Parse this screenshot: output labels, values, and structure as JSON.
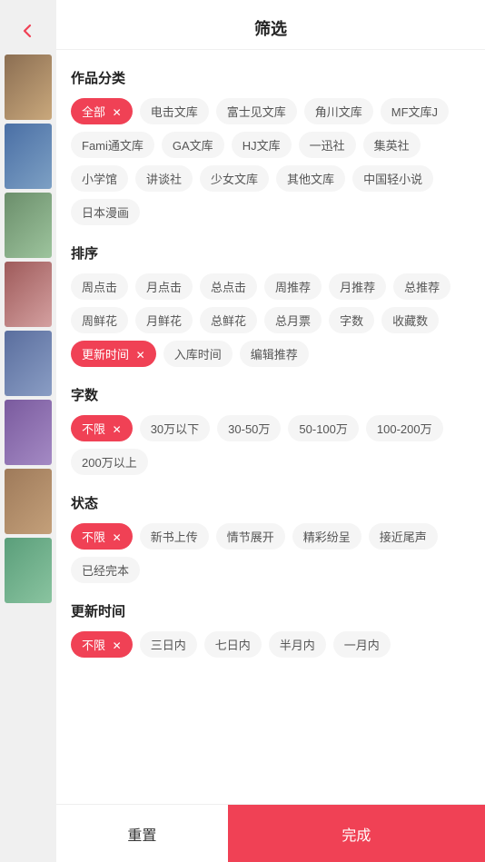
{
  "header": {
    "title": "筛选",
    "back_icon": "‹"
  },
  "sections": {
    "category": {
      "title": "作品分类",
      "tags": [
        {
          "label": "全部",
          "active": true,
          "has_close": true
        },
        {
          "label": "电击文库",
          "active": false
        },
        {
          "label": "富士见文库",
          "active": false
        },
        {
          "label": "角川文库",
          "active": false
        },
        {
          "label": "MF文库J",
          "active": false
        },
        {
          "label": "Fami通文库",
          "active": false
        },
        {
          "label": "GA文库",
          "active": false
        },
        {
          "label": "HJ文库",
          "active": false
        },
        {
          "label": "一迅社",
          "active": false
        },
        {
          "label": "集英社",
          "active": false
        },
        {
          "label": "小学馆",
          "active": false
        },
        {
          "label": "讲谈社",
          "active": false
        },
        {
          "label": "少女文库",
          "active": false
        },
        {
          "label": "其他文库",
          "active": false
        },
        {
          "label": "中国轻小说",
          "active": false
        },
        {
          "label": "日本漫画",
          "active": false
        }
      ]
    },
    "sort": {
      "title": "排序",
      "tags": [
        {
          "label": "周点击",
          "active": false
        },
        {
          "label": "月点击",
          "active": false
        },
        {
          "label": "总点击",
          "active": false
        },
        {
          "label": "周推荐",
          "active": false
        },
        {
          "label": "月推荐",
          "active": false
        },
        {
          "label": "总推荐",
          "active": false
        },
        {
          "label": "周鲜花",
          "active": false
        },
        {
          "label": "月鲜花",
          "active": false
        },
        {
          "label": "总鲜花",
          "active": false
        },
        {
          "label": "总月票",
          "active": false
        },
        {
          "label": "字数",
          "active": false
        },
        {
          "label": "收藏数",
          "active": false
        },
        {
          "label": "更新时间",
          "active": true,
          "has_close": true
        },
        {
          "label": "入库时间",
          "active": false
        },
        {
          "label": "编辑推荐",
          "active": false
        }
      ]
    },
    "wordcount": {
      "title": "字数",
      "tags": [
        {
          "label": "不限",
          "active": true,
          "has_close": true
        },
        {
          "label": "30万以下",
          "active": false
        },
        {
          "label": "30-50万",
          "active": false
        },
        {
          "label": "50-100万",
          "active": false
        },
        {
          "label": "100-200万",
          "active": false
        },
        {
          "label": "200万以上",
          "active": false
        }
      ]
    },
    "status": {
      "title": "状态",
      "tags": [
        {
          "label": "不限",
          "active": true,
          "has_close": true
        },
        {
          "label": "新书上传",
          "active": false
        },
        {
          "label": "情节展开",
          "active": false
        },
        {
          "label": "精彩纷呈",
          "active": false
        },
        {
          "label": "接近尾声",
          "active": false
        },
        {
          "label": "已经完本",
          "active": false
        }
      ]
    },
    "update_time": {
      "title": "更新时间",
      "tags": [
        {
          "label": "不限",
          "active": true,
          "has_close": true
        },
        {
          "label": "三日内",
          "active": false
        },
        {
          "label": "七日内",
          "active": false
        },
        {
          "label": "半月内",
          "active": false
        },
        {
          "label": "一月内",
          "active": false
        }
      ]
    }
  },
  "footer": {
    "reset_label": "重置",
    "confirm_label": "完成"
  },
  "colors": {
    "accent": "#f04155"
  }
}
